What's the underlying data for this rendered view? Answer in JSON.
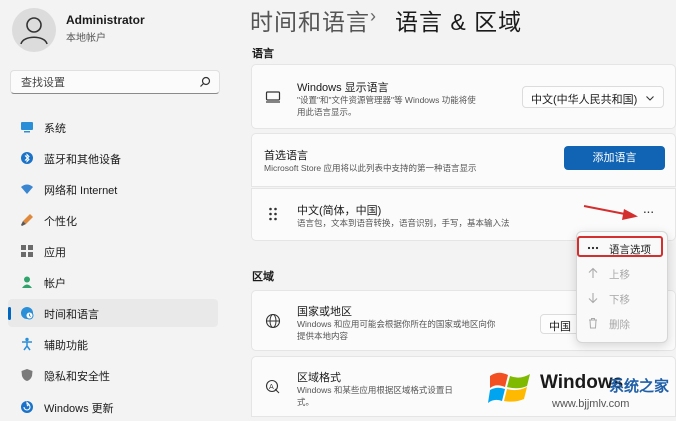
{
  "user": {
    "name": "Administrator",
    "account_type": "本地帐户"
  },
  "search": {
    "placeholder": "查找设置"
  },
  "sidebar": {
    "items": [
      {
        "label": "系统",
        "icon": "monitor-icon"
      },
      {
        "label": "蓝牙和其他设备",
        "icon": "bluetooth-icon"
      },
      {
        "label": "网络和 Internet",
        "icon": "wifi-icon"
      },
      {
        "label": "个性化",
        "icon": "brush-icon"
      },
      {
        "label": "应用",
        "icon": "apps-icon"
      },
      {
        "label": "帐户",
        "icon": "person-icon"
      },
      {
        "label": "时间和语言",
        "icon": "globe-clock-icon",
        "active": true
      },
      {
        "label": "辅助功能",
        "icon": "accessibility-icon"
      },
      {
        "label": "隐私和安全性",
        "icon": "shield-icon"
      },
      {
        "label": "Windows 更新",
        "icon": "update-icon"
      }
    ]
  },
  "header": {
    "parent": "时间和语言",
    "separator": "›",
    "title": "语言 & 区域"
  },
  "language_section": {
    "heading": "语言",
    "display_language": {
      "title": "Windows 显示语言",
      "desc_line1": "\"设置\"和\"文件资源管理器\"等 Windows 功能将使",
      "desc_line2": "用此语言显示。",
      "value": "中文(中华人民共和国)"
    },
    "preferred": {
      "title": "首选语言",
      "desc": "Microsoft Store 应用将以此列表中支持的第一种语言显示",
      "button": "添加语言"
    },
    "language_item": {
      "title": "中文(简体，中国)",
      "desc": "语言包，文本到语音转换，语音识别，手写，基本输入法",
      "more": "···"
    }
  },
  "context_menu": {
    "items": [
      {
        "label": "语言选项",
        "icon": "more-icon",
        "enabled": true
      },
      {
        "label": "上移",
        "icon": "arrow-up-icon",
        "enabled": false
      },
      {
        "label": "下移",
        "icon": "arrow-down-icon",
        "enabled": false
      },
      {
        "label": "删除",
        "icon": "trash-icon",
        "enabled": false
      }
    ]
  },
  "region_section": {
    "heading": "区域",
    "country": {
      "title": "国家或地区",
      "desc_line1": "Windows 和应用可能会根据你所在的国家或地区向你",
      "desc_line2": "提供本地内容",
      "value": "中国"
    },
    "format": {
      "title": "区域格式",
      "desc_line1": "Windows 和某些应用根据区域格式设置日",
      "desc_line2": "式。"
    }
  },
  "watermark": {
    "brand": "Windows",
    "site_cn": "系统之家",
    "url": "www.bjjmlv.com"
  },
  "colors": {
    "accent": "#1164b4",
    "annotation_red": "#d32f2f",
    "sidebar_active": "#e9e9e9"
  }
}
